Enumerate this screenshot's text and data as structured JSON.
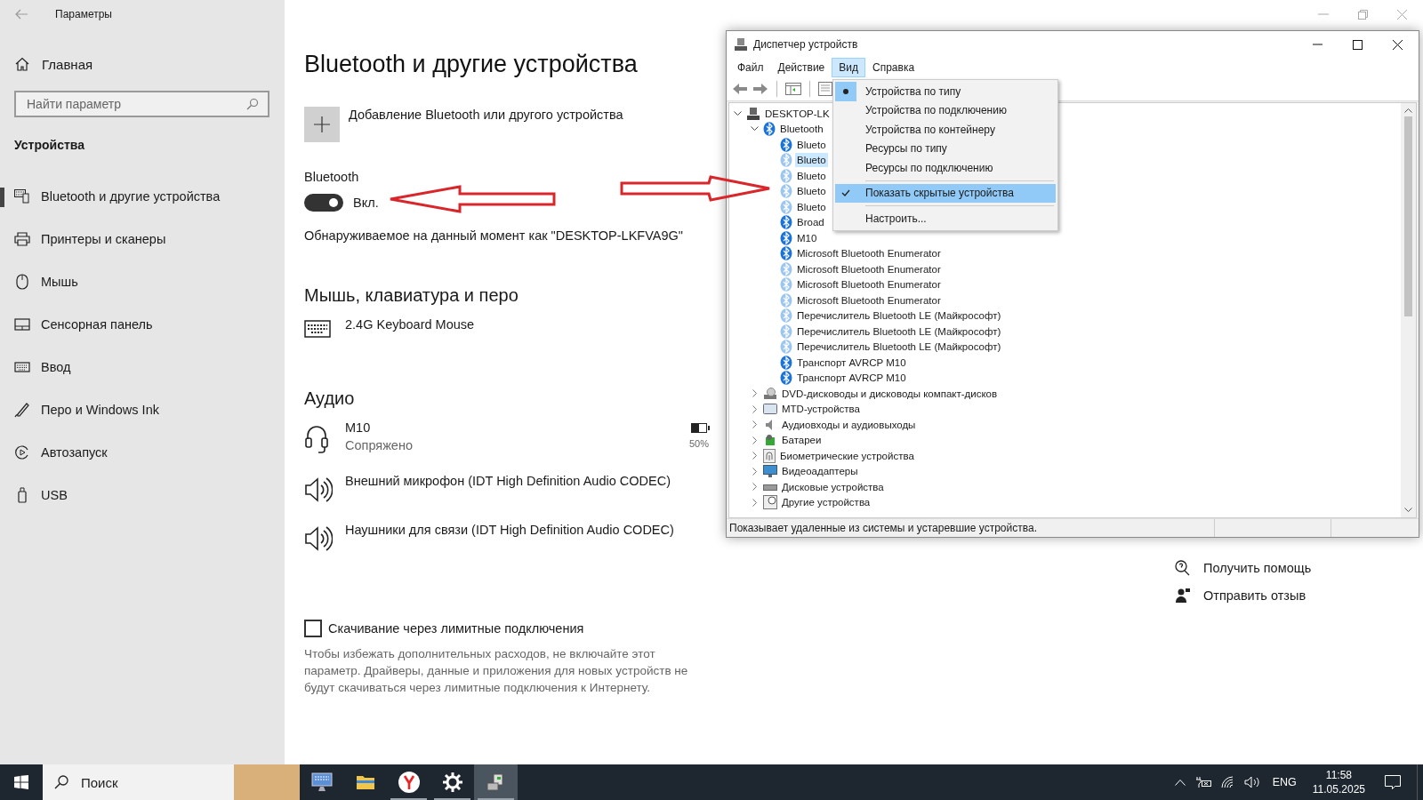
{
  "settings": {
    "title": "Параметры",
    "home": "Главная",
    "search": {
      "placeholder": "Найти параметр"
    },
    "section": "Устройства",
    "nav": [
      {
        "label": "Bluetooth и другие устройства",
        "kind": "devices",
        "selected": true
      },
      {
        "label": "Принтеры и сканеры",
        "kind": "printer",
        "selected": false
      },
      {
        "label": "Мышь",
        "kind": "mouse",
        "selected": false
      },
      {
        "label": "Сенсорная панель",
        "kind": "touchpad",
        "selected": false
      },
      {
        "label": "Ввод",
        "kind": "keyboard",
        "selected": false
      },
      {
        "label": "Перо и Windows Ink",
        "kind": "pen",
        "selected": false
      },
      {
        "label": "Автозапуск",
        "kind": "autoplay",
        "selected": false
      },
      {
        "label": "USB",
        "kind": "usb",
        "selected": false
      }
    ],
    "page_title": "Bluetooth и другие устройства",
    "add_device": "Добавление Bluetooth или другого устройства",
    "bluetooth": {
      "label": "Bluetooth",
      "on": true,
      "state_text": "Вкл."
    },
    "discoverable": "Обнаруживаемое на данный момент как \"DESKTOP-LKFVA9G\"",
    "groups": [
      {
        "heading": "Мышь, клавиатура и перо",
        "devices": [
          {
            "kind": "keyboard",
            "name": "2.4G Keyboard Mouse"
          }
        ]
      },
      {
        "heading": "Аудио",
        "devices": [
          {
            "kind": "headset",
            "name": "M10",
            "status": "Сопряжено",
            "battery": {
              "level": 0.5,
              "text": "50%"
            }
          },
          {
            "kind": "speaker",
            "name": "Внешний микрофон (IDT High Definition Audio CODEC)"
          },
          {
            "kind": "speaker",
            "name": "Наушники для связи (IDT High Definition Audio CODEC)"
          }
        ]
      }
    ],
    "metered": {
      "label": "Скачивание через лимитные подключения",
      "checked": false,
      "description": "Чтобы избежать дополнительных расходов, не включайте этот параметр. Драйверы, данные и приложения для новых устройств не будут скачиваться через лимитные подключения к Интернету."
    },
    "links": [
      {
        "kind": "help",
        "label": "Получить помощь"
      },
      {
        "kind": "feedback",
        "label": "Отправить отзыв"
      }
    ]
  },
  "device_manager": {
    "title": "Диспетчер устройств",
    "menu": [
      {
        "label": "Файл",
        "selected": false
      },
      {
        "label": "Действие",
        "selected": false
      },
      {
        "label": "Вид",
        "selected": true
      },
      {
        "label": "Справка",
        "selected": false
      }
    ],
    "view_menu": {
      "groups": [
        {
          "items": [
            {
              "label": "Устройства по типу",
              "kind": "radio",
              "checked": true,
              "selected": false
            },
            {
              "label": "Устройства по подключению",
              "kind": "radio",
              "checked": false,
              "selected": false
            },
            {
              "label": "Устройства по контейнеру",
              "kind": "radio",
              "checked": false,
              "selected": false
            },
            {
              "label": "Ресурсы по типу",
              "kind": "radio",
              "checked": false,
              "selected": false
            },
            {
              "label": "Ресурсы по подключению",
              "kind": "radio",
              "checked": false,
              "selected": false
            }
          ]
        },
        {
          "items": [
            {
              "label": "Показать скрытые устройства",
              "kind": "check",
              "checked": true,
              "selected": true
            }
          ]
        },
        {
          "items": [
            {
              "label": "Настроить...",
              "kind": "action",
              "checked": false,
              "selected": false
            }
          ]
        }
      ]
    },
    "tree": [
      {
        "label": "DESKTOP-LK",
        "kind": "computer",
        "expanded": true,
        "selected": false,
        "children": [
          {
            "label": "Bluetooth",
            "kind": "bluetooth",
            "expanded": true,
            "hidden": false,
            "selected": false,
            "children": [
              {
                "label": "Blueto",
                "kind": "bluetooth",
                "hidden": false,
                "selected": false
              },
              {
                "label": "Blueto",
                "kind": "bluetooth",
                "hidden": true,
                "selected": true
              },
              {
                "label": "Blueto",
                "kind": "bluetooth",
                "hidden": true,
                "selected": false
              },
              {
                "label": "Blueto",
                "kind": "bluetooth",
                "hidden": true,
                "selected": false
              },
              {
                "label": "Blueto",
                "kind": "bluetooth",
                "hidden": true,
                "selected": false
              },
              {
                "label": "Broad",
                "kind": "bluetooth",
                "hidden": false,
                "selected": false
              },
              {
                "label": "M10",
                "kind": "bluetooth",
                "hidden": false,
                "selected": false
              },
              {
                "label": "Microsoft Bluetooth Enumerator",
                "kind": "bluetooth",
                "hidden": false,
                "selected": false
              },
              {
                "label": "Microsoft Bluetooth Enumerator",
                "kind": "bluetooth",
                "hidden": true,
                "selected": false
              },
              {
                "label": "Microsoft Bluetooth Enumerator",
                "kind": "bluetooth",
                "hidden": true,
                "selected": false
              },
              {
                "label": "Microsoft Bluetooth Enumerator",
                "kind": "bluetooth",
                "hidden": true,
                "selected": false
              },
              {
                "label": "Перечислитель Bluetooth LE (Майкрософт)",
                "kind": "bluetooth",
                "hidden": true,
                "selected": false
              },
              {
                "label": "Перечислитель Bluetooth LE (Майкрософт)",
                "kind": "bluetooth",
                "hidden": true,
                "selected": false
              },
              {
                "label": "Перечислитель Bluetooth LE (Майкрософт)",
                "kind": "bluetooth",
                "hidden": true,
                "selected": false
              },
              {
                "label": "Транспорт AVRCP M10",
                "kind": "bluetooth",
                "hidden": false,
                "selected": false
              },
              {
                "label": "Транспорт AVRCP M10",
                "kind": "bluetooth",
                "hidden": false,
                "selected": false
              }
            ]
          },
          {
            "label": "DVD-дисководы и дисководы компакт-дисков",
            "kind": "dvd",
            "expanded": false,
            "selected": false
          },
          {
            "label": "MTD-устройства",
            "kind": "mtd",
            "expanded": false,
            "selected": false
          },
          {
            "label": "Аудиовходы и аудиовыходы",
            "kind": "audio",
            "expanded": false,
            "selected": false
          },
          {
            "label": "Батареи",
            "kind": "battery",
            "expanded": false,
            "selected": false
          },
          {
            "label": "Биометрические устройства",
            "kind": "biometric",
            "expanded": false,
            "selected": false
          },
          {
            "label": "Видеоадаптеры",
            "kind": "display",
            "expanded": false,
            "selected": false
          },
          {
            "label": "Дисковые устройства",
            "kind": "disk",
            "expanded": false,
            "selected": false
          },
          {
            "label": "Другие устройства",
            "kind": "other",
            "expanded": false,
            "selected": false
          }
        ]
      }
    ],
    "status_bar": "Показывает удаленные из системы и устаревшие устройства."
  },
  "taskbar": {
    "search": {
      "placeholder": "Поиск"
    },
    "apps": [
      {
        "kind": "monitor",
        "running": false,
        "active": false
      },
      {
        "kind": "folder",
        "running": false,
        "active": false
      },
      {
        "kind": "browser",
        "running": true,
        "active": false
      },
      {
        "kind": "gear",
        "running": true,
        "active": false
      },
      {
        "kind": "devmgr",
        "running": true,
        "active": true
      }
    ],
    "language": "ENG",
    "time": "11:58",
    "date": "11.05.2025"
  }
}
